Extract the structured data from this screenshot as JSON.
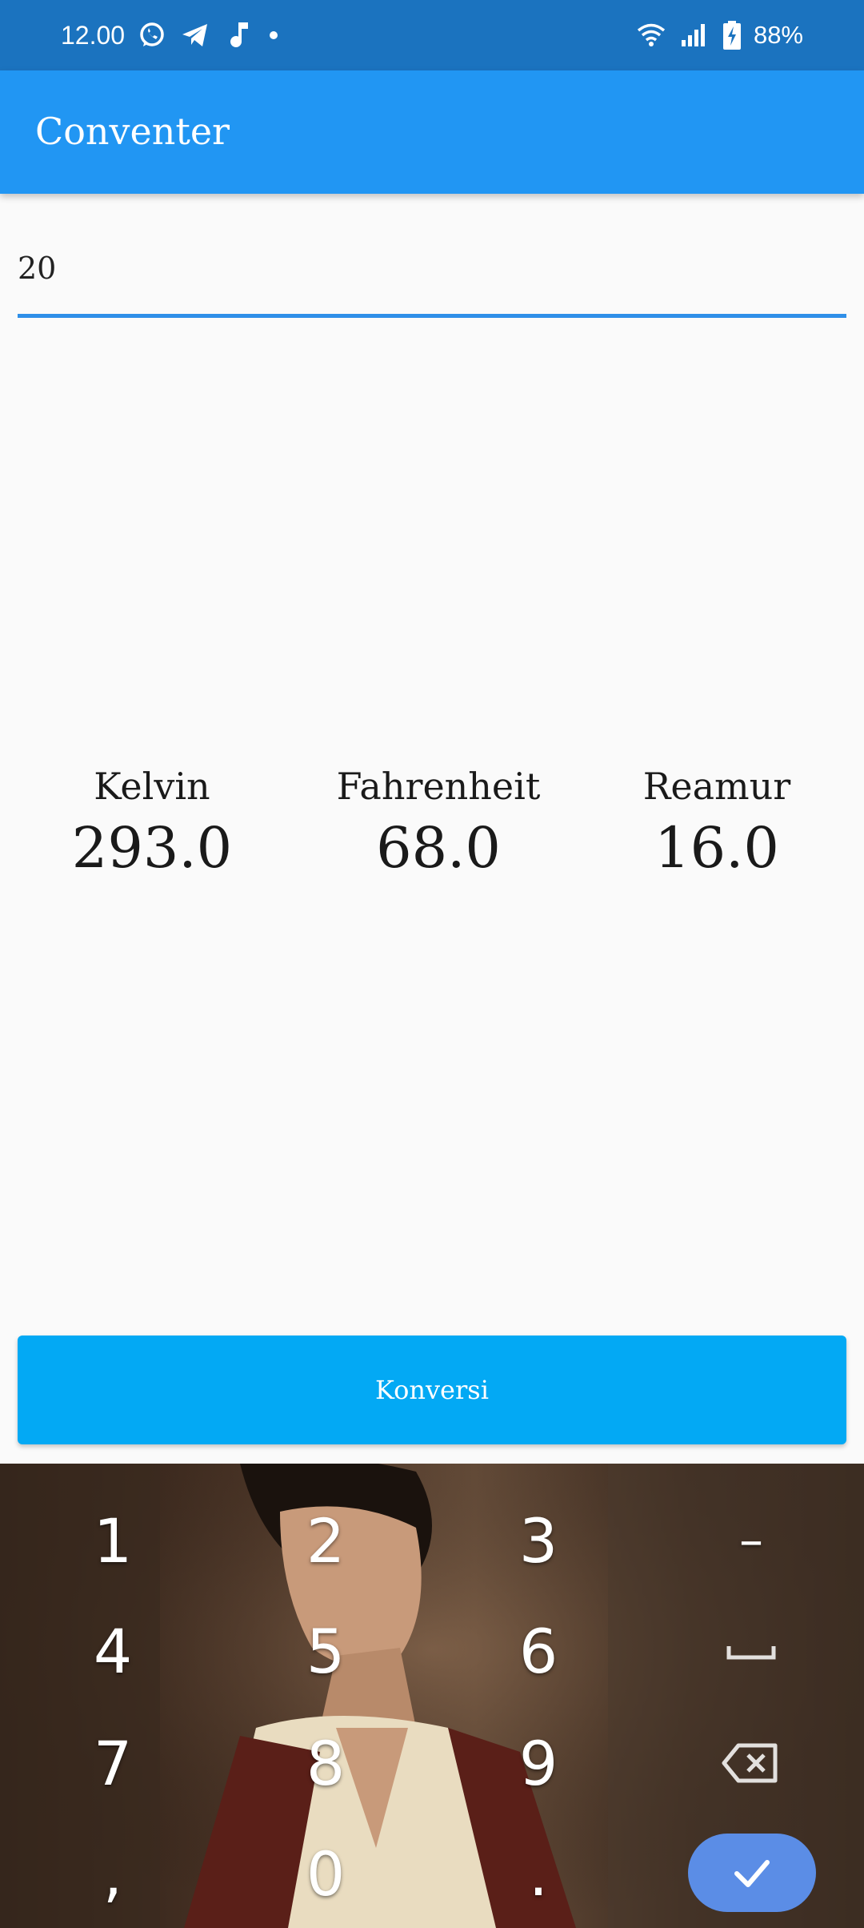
{
  "status_bar": {
    "time": "12.00",
    "battery": "88%",
    "left_icons": [
      "whatsapp-icon",
      "telegram-icon",
      "music-note-icon",
      "dot-icon"
    ],
    "right_icons": [
      "wifi-icon",
      "signal-icon",
      "battery-charging-icon"
    ]
  },
  "app_bar": {
    "title": "Conventer"
  },
  "input": {
    "value": "20"
  },
  "results": [
    {
      "label": "Kelvin",
      "value": "293.0"
    },
    {
      "label": "Fahrenheit",
      "value": "68.0"
    },
    {
      "label": "Reamur",
      "value": "16.0"
    }
  ],
  "convert_button": {
    "label": "Konversi"
  },
  "keyboard": {
    "keys": {
      "k1": "1",
      "k2": "2",
      "k3": "3",
      "minus": "–",
      "k4": "4",
      "k5": "5",
      "k6": "6",
      "k7": "7",
      "k8": "8",
      "k9": "9",
      "comma": ",",
      "k0": "0",
      "period": "."
    },
    "special_icons": [
      "space-icon",
      "backspace-icon",
      "checkmark-icon"
    ],
    "done_color": "#5b8de6"
  },
  "colors": {
    "status_bar": "#1b73bf",
    "app_bar": "#2196f3",
    "button": "#03a9f4",
    "underline": "#2f8fe8"
  }
}
